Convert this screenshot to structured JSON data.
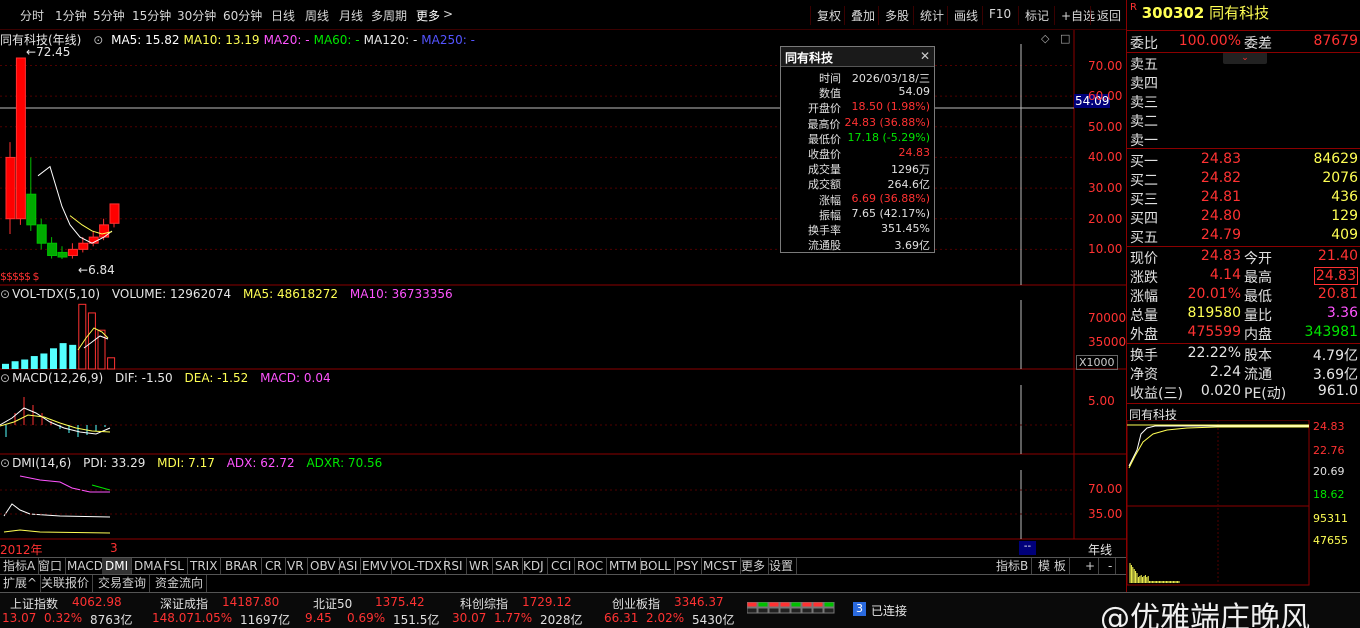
{
  "toolbar": {
    "periods": [
      "分时",
      "1分钟",
      "5分钟",
      "15分钟",
      "30分钟",
      "60分钟",
      "日线",
      "周线",
      "月线",
      "多周期",
      "更多"
    ],
    "right_buttons": [
      "复权",
      "叠加",
      "多股",
      "统计",
      "画线",
      "F10",
      "标记",
      "+自选",
      "返回"
    ]
  },
  "main_chart": {
    "legend_title": "同有科技(年线)",
    "ma_items": [
      {
        "label": "MA5: 15.82",
        "color": "#ffffff"
      },
      {
        "label": "MA10: 13.19",
        "color": "#ffff54"
      },
      {
        "label": "MA20: -",
        "color": "#ff54ff"
      },
      {
        "label": "MA60: -",
        "color": "#00e600"
      },
      {
        "label": "MA120: -",
        "color": "#e6e6e6"
      },
      {
        "label": "MA250: -",
        "color": "#5454ff"
      }
    ],
    "high_label": "72.45",
    "low_label": "6.84",
    "cursor_value": "54.09",
    "y_ticks": [
      "70.00",
      "60.00",
      "50.00",
      "40.00",
      "30.00",
      "20.00",
      "10.00"
    ]
  },
  "vol_panel": {
    "legend": "VOL-TDX(5,10)",
    "volume": "VOLUME: 12962074",
    "ma5": "MA5: 48618272",
    "ma10": "MA10: 36733356",
    "y_ticks": [
      "70000",
      "35000"
    ],
    "unit": "X1000"
  },
  "macd_panel": {
    "legend": "MACD(12,26,9)",
    "dif": "DIF: -1.50",
    "dea": "DEA: -1.52",
    "macd": "MACD: 0.04",
    "y_ticks": [
      "5.00"
    ]
  },
  "dmi_panel": {
    "legend": "DMI(14,6)",
    "pdi": "PDI: 33.29",
    "mdi": "MDI: 7.17",
    "adx": "ADX: 62.72",
    "adxr": "ADXR: 70.56",
    "y_ticks": [
      "70.00",
      "35.00"
    ]
  },
  "x_axis": {
    "start": "2012年",
    "mark": "3",
    "label": "年线"
  },
  "popup": {
    "title": "同有科技",
    "rows": [
      {
        "k": "时间",
        "v": "2026/03/18/三",
        "color": "#e0e0e0"
      },
      {
        "k": "数值",
        "v": "54.09",
        "color": "#e0e0e0"
      },
      {
        "k": "开盘价",
        "v": "18.50 (1.98%)",
        "color": "#ff3232"
      },
      {
        "k": "最高价",
        "v": "24.83 (36.88%)",
        "color": "#ff3232"
      },
      {
        "k": "最低价",
        "v": "17.18 (-5.29%)",
        "color": "#00e600"
      },
      {
        "k": "收盘价",
        "v": "24.83",
        "color": "#ff3232"
      },
      {
        "k": "成交量",
        "v": "1296万",
        "color": "#e0e0e0"
      },
      {
        "k": "成交额",
        "v": "264.6亿",
        "color": "#e0e0e0"
      },
      {
        "k": "涨幅",
        "v": "6.69 (36.88%)",
        "color": "#ff3232"
      },
      {
        "k": "振幅",
        "v": "7.65 (42.17%)",
        "color": "#e0e0e0"
      },
      {
        "k": "换手率",
        "v": "351.45%",
        "color": "#e0e0e0"
      },
      {
        "k": "流通股",
        "v": "3.69亿",
        "color": "#e0e0e0"
      }
    ]
  },
  "quote": {
    "code": "300302",
    "name": "同有科技",
    "weibi_label": "委比",
    "weibi": "100.00%",
    "weicha_label": "委差",
    "weicha": "87679",
    "sell": [
      "卖五",
      "卖四",
      "卖三",
      "卖二",
      "卖一"
    ],
    "buy": [
      {
        "label": "买一",
        "price": "24.83",
        "vol": "84629"
      },
      {
        "label": "买二",
        "price": "24.82",
        "vol": "2076"
      },
      {
        "label": "买三",
        "price": "24.81",
        "vol": "436"
      },
      {
        "label": "买四",
        "price": "24.80",
        "vol": "129"
      },
      {
        "label": "买五",
        "price": "24.79",
        "vol": "409"
      }
    ],
    "stats": [
      {
        "k1": "现价",
        "v1": "24.83",
        "c1": "#ff3232",
        "k2": "今开",
        "v2": "21.40",
        "c2": "#ff3232"
      },
      {
        "k1": "涨跌",
        "v1": "4.14",
        "c1": "#ff3232",
        "k2": "最高",
        "v2": "24.83",
        "c2": "#ff3232"
      },
      {
        "k1": "涨幅",
        "v1": "20.01%",
        "c1": "#ff3232",
        "k2": "最低",
        "v2": "20.81",
        "c2": "#ff3232"
      },
      {
        "k1": "总量",
        "v1": "819580",
        "c1": "#ffff54",
        "k2": "量比",
        "v2": "3.36",
        "c2": "#ff54ff"
      },
      {
        "k1": "外盘",
        "v1": "475599",
        "c1": "#ff3232",
        "k2": "内盘",
        "v2": "343981",
        "c2": "#00e600"
      }
    ],
    "stats2": [
      {
        "k1": "换手",
        "v1": "22.22%",
        "k2": "股本",
        "v2": "4.79亿"
      },
      {
        "k1": "净资",
        "v1": "2.24",
        "k2": "流通",
        "v2": "3.69亿"
      },
      {
        "k1": "收益(三)",
        "v1": "0.020",
        "k2": "PE(动)",
        "v2": "961.0"
      }
    ],
    "mini_title": "同有科技",
    "mini_prices": [
      "24.83",
      "22.76",
      "20.69",
      "18.62"
    ],
    "mini_vols": [
      "95311",
      "47655"
    ]
  },
  "tabs": [
    "指标A",
    "窗口",
    "MACD",
    "DMI",
    "DMA",
    "FSL",
    "TRIX",
    "BRAR",
    "CR",
    "VR",
    "OBV",
    "ASI",
    "EMV",
    "VOL-TDX",
    "RSI",
    "WR",
    "SAR",
    "KDJ",
    "CCI",
    "ROC",
    "MTM",
    "BOLL",
    "PSY",
    "MCST",
    "更多",
    "设置"
  ],
  "tabs_right": [
    "指标B",
    "模 板"
  ],
  "tabs2": [
    "扩展^",
    "关联报价",
    "交易查询",
    "资金流向"
  ],
  "status": {
    "indices": [
      {
        "name": "上证指数",
        "value": "4062.98",
        "chg": "13.07",
        "pct": "0.32%",
        "amt": "8763亿"
      },
      {
        "name": "深证成指",
        "value": "14187.80",
        "chg": "148.07",
        "pct": "1.05%",
        "amt": "11697亿"
      },
      {
        "name": "北证50",
        "value": "1375.42",
        "chg": "9.45",
        "pct": "0.69%",
        "amt": "151.5亿"
      },
      {
        "name": "科创综指",
        "value": "1729.12",
        "chg": "30.07",
        "pct": "1.77%",
        "amt": "2028亿"
      },
      {
        "name": "创业板指",
        "value": "3346.37",
        "chg": "66.31",
        "pct": "2.02%",
        "amt": "5430亿"
      }
    ],
    "conn_num": "3",
    "conn_text": "已连接",
    "watermark": "@优雅端庄晚风"
  }
}
